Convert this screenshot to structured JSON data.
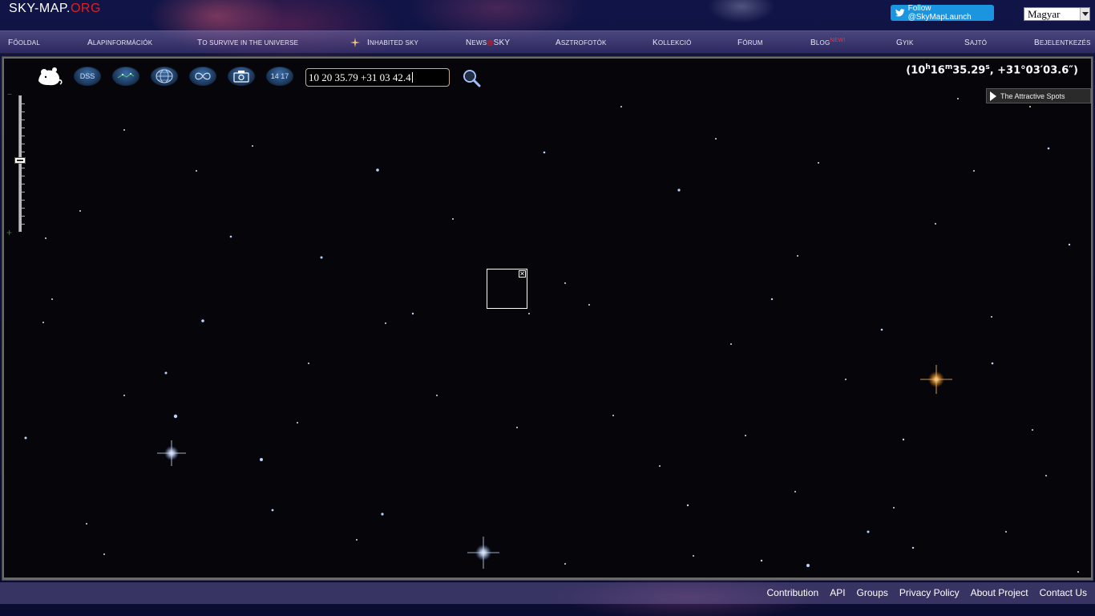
{
  "site": {
    "logo_main": "SKY-MAP.",
    "logo_tld": "ORG"
  },
  "twitter": {
    "label": "Follow @SkyMapLaunch"
  },
  "language": {
    "selected": "Magyar"
  },
  "nav": {
    "items": [
      {
        "cap": "F",
        "rest": "őoldal"
      },
      {
        "cap": "A",
        "rest": "lapinformációk"
      },
      {
        "cap": "T",
        "rest": "o Survive in the Universe"
      },
      {
        "cap": "I",
        "rest": "nhabited Sky"
      },
      {
        "cap": "N",
        "rest": "ews"
      },
      {
        "cap": "A",
        "rest": "sztrofotók"
      },
      {
        "cap": "K",
        "rest": "ollekció"
      },
      {
        "cap": "F",
        "rest": "órum"
      },
      {
        "cap": "B",
        "rest": "log"
      },
      {
        "cap": "G",
        "rest": "YIK"
      },
      {
        "cap": "S",
        "rest": "ajtó"
      },
      {
        "cap": "B",
        "rest": "ejelentkezés"
      }
    ],
    "news_at": "@",
    "news_sky": "Sky",
    "blog_new": "New!"
  },
  "toolbar": {
    "dss_label": "DSS",
    "date_label": "14 17",
    "search_value": "10 20 35.79 +31 03 42.4"
  },
  "coords": {
    "open": "(10",
    "h": "h",
    "min_val": "16",
    "m": "m",
    "sec_val": "35.29",
    "s": "s",
    "dec": ", +31°03′03.6″)"
  },
  "attractive_spots": {
    "label": "The Attractive Spots"
  },
  "zoom": {
    "minus": "−",
    "plus": "+"
  },
  "target": {
    "close": "✕"
  },
  "footer": {
    "links": [
      "Contribution",
      "API",
      "Groups",
      "Privacy Policy",
      "About Project",
      "Contact Us"
    ]
  },
  "colors": {
    "accent_red": "#e02020",
    "twitter_blue": "#1b95e0",
    "sky_bg": "#06060a"
  }
}
